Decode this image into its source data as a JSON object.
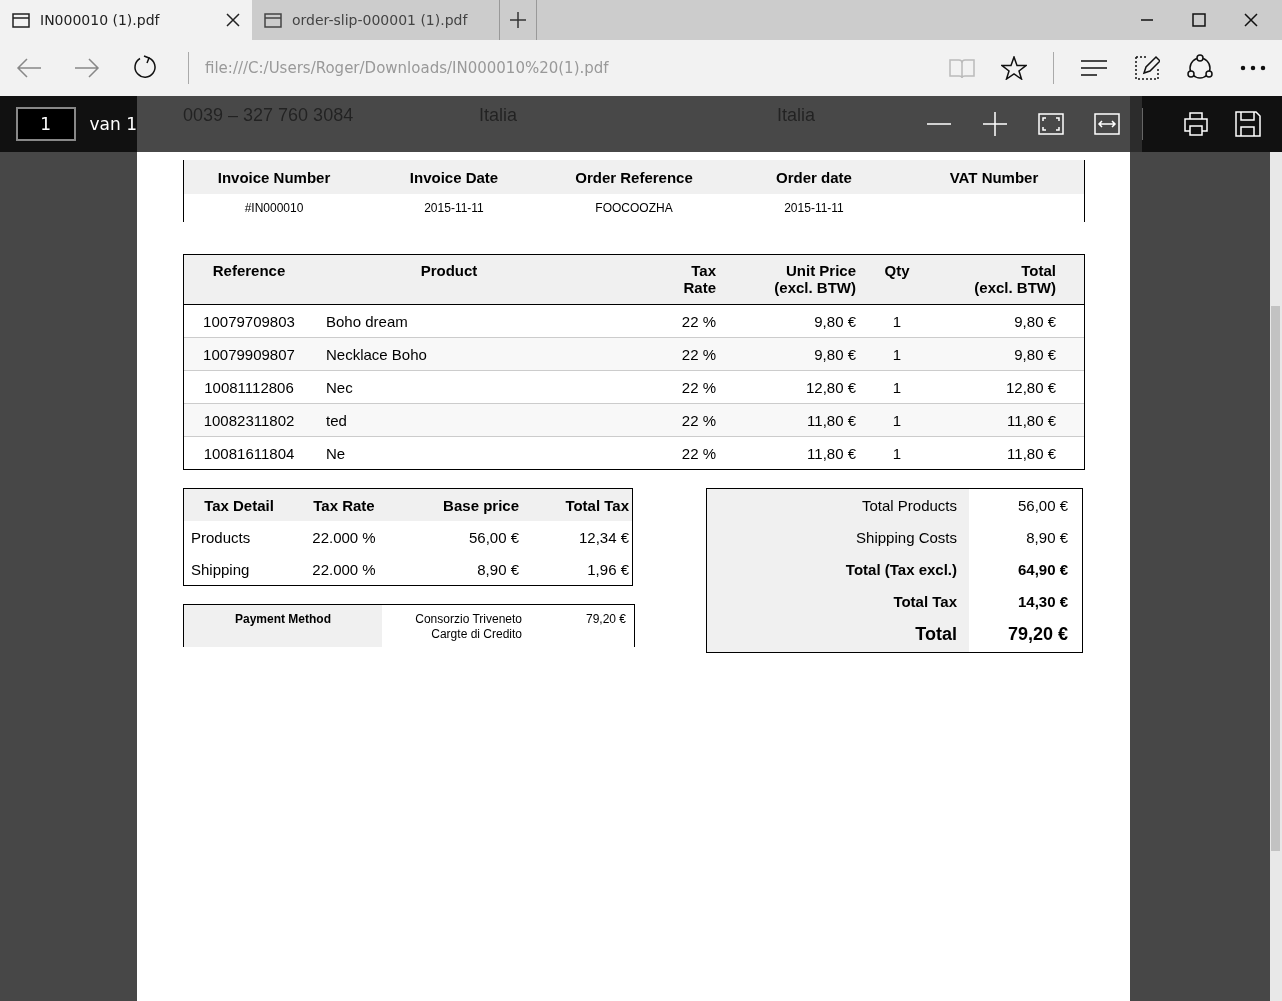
{
  "tabs": [
    {
      "title": "IN000010 (1).pdf",
      "selected": true
    },
    {
      "title": "order-slip-000001 (1).pdf",
      "selected": false
    }
  ],
  "address_bar": {
    "url": "file:///C:/Users/Roger/Downloads/IN000010%20(1).pdf"
  },
  "pdf_toolbar": {
    "page": "1",
    "page_count": "van 1"
  },
  "document": {
    "address_lines": [
      "0039 – 327 760 3084",
      "Italia",
      "Italia"
    ],
    "info_table": {
      "columns": [
        "Invoice Number",
        "Invoice Date",
        "Order Reference",
        "Order date",
        "VAT Number"
      ],
      "values": [
        "#IN000010",
        "2015-11-11",
        "FOOCOOZHA",
        "2015-11-11"
      ]
    },
    "products": {
      "columns": [
        [
          "Reference"
        ],
        [
          "Product"
        ],
        [
          "Tax",
          "Rate"
        ],
        [
          "Unit Price",
          "(excl. BTW)"
        ],
        [
          "Qty"
        ],
        [
          "Total",
          "(excl. BTW)"
        ]
      ],
      "rows": [
        {
          "reference": "10079709803",
          "product": "Boho dream",
          "tax_rate": "22 %",
          "unit_price": "9,80 €",
          "qty": "1",
          "total": "9,80 €"
        },
        {
          "reference": "10079909807",
          "product": "Necklace Boho",
          "tax_rate": "22 %",
          "unit_price": "9,80 €",
          "qty": "1",
          "total": "9,80 €"
        },
        {
          "reference": "10081112806",
          "product": "Nec",
          "tax_rate": "22 %",
          "unit_price": "12,80 €",
          "qty": "1",
          "total": "12,80 €"
        },
        {
          "reference": "10082311802",
          "product": "ted",
          "tax_rate": "22 %",
          "unit_price": "11,80 €",
          "qty": "1",
          "total": "11,80 €"
        },
        {
          "reference": "10081611804",
          "product": "Ne",
          "tax_rate": "22 %",
          "unit_price": "11,80 €",
          "qty": "1",
          "total": "11,80 €"
        }
      ]
    },
    "tax_table": {
      "columns": [
        "Tax Detail",
        "Tax Rate",
        "Base price",
        "Total Tax"
      ],
      "rows": [
        [
          "Products",
          "22.000 %",
          "56,00 €",
          "12,34 €"
        ],
        [
          "Shipping",
          "22.000 %",
          "8,90 €",
          "1,96 €"
        ]
      ]
    },
    "payment": {
      "label": "Payment Method",
      "method": [
        "Consorzio Triveneto",
        "Cargte di Credito"
      ],
      "amount": "79,20 €"
    },
    "totals": [
      {
        "label": "Total Products",
        "value": "56,00 €",
        "kind": "normal"
      },
      {
        "label": "Shipping Costs",
        "value": "8,90 €",
        "kind": "normal"
      },
      {
        "label": "Total (Tax excl.)",
        "value": "64,90 €",
        "kind": "bold"
      },
      {
        "label": "Total Tax",
        "value": "14,30 €",
        "kind": "bold"
      },
      {
        "label": "Total",
        "value": "79,20 €",
        "kind": "grand"
      }
    ]
  }
}
